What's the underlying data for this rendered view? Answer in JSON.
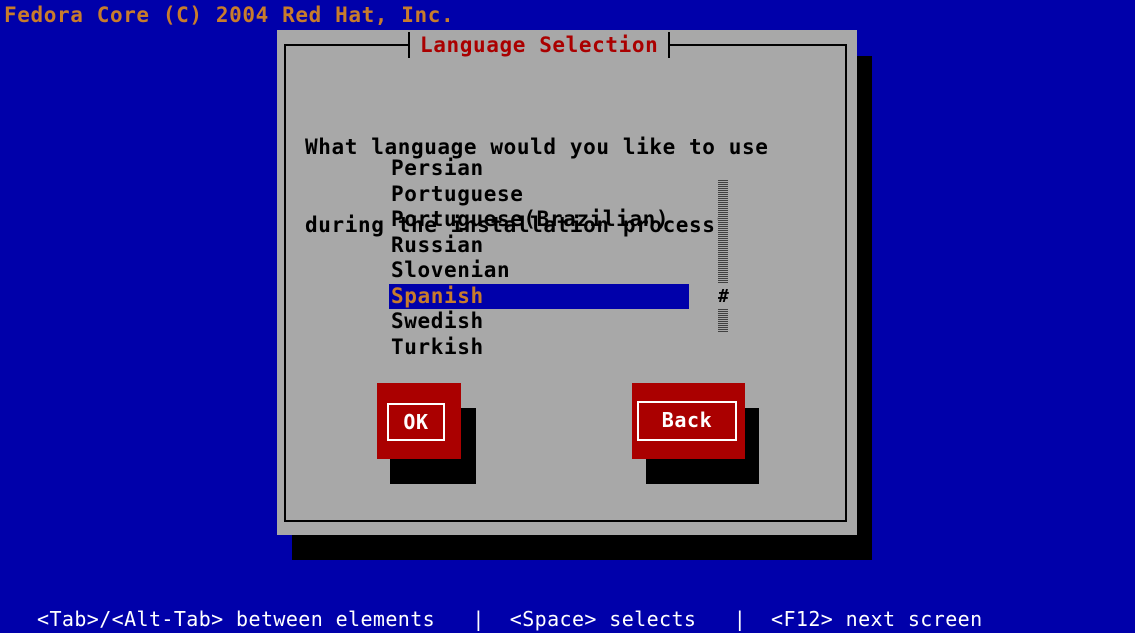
{
  "top_banner": "Fedora Core (C) 2004 Red Hat, Inc.",
  "dialog": {
    "title": "Language Selection",
    "question_line1": "What language would you like to use",
    "question_line2": "during the installation process?"
  },
  "languages": {
    "items": [
      "Persian",
      "Portuguese",
      "Portuguese(Brazilian)",
      "Russian",
      "Slovenian",
      "Spanish",
      "Swedish",
      "Turkish"
    ],
    "selected": "Spanish"
  },
  "scrollbar": {
    "thumb_glyph": "#"
  },
  "buttons": {
    "ok_label": "OK",
    "back_label": "Back"
  },
  "help_line": {
    "text": "<Tab>/<Alt-Tab> between elements   |  <Space> selects   |  <F12> next screen"
  },
  "colors": {
    "background": "#0000aa",
    "dialog": "#a8a8a8",
    "accent": "#aa0000",
    "banner_text": "#c87c2c"
  }
}
